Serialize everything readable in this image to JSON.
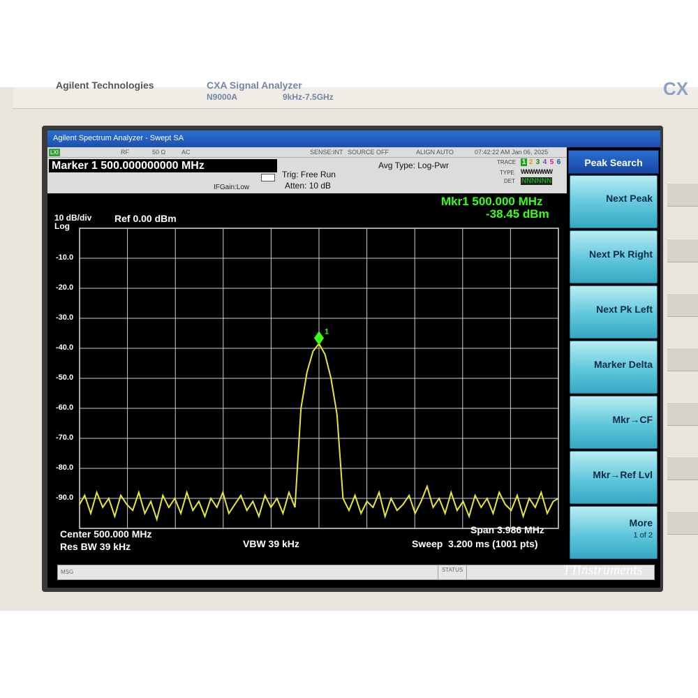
{
  "bezel": {
    "brand": "Agilent Technologies",
    "product": "CXA Signal Analyzer",
    "model": "N9000A",
    "range": "9kHz-7.5GHz",
    "series_mark": "CX"
  },
  "window": {
    "title": "Agilent Spectrum Analyzer - Swept SA"
  },
  "header": {
    "mode_badge": "LXI",
    "rf": "RF",
    "impedance": "50 Ω",
    "coupling": "AC",
    "sense": "SENSE:INT",
    "source": "SOURCE OFF",
    "align": "ALIGN AUTO",
    "timestamp": "07:42:22 AM Jan 06, 2025",
    "marker_readout": "Marker 1 500.000000000 MHz",
    "trigger": "Trig: Free Run",
    "atten": "Atten: 10 dB",
    "ifgain": "IFGain:Low",
    "avg_type": "Avg Type: Log-Pwr",
    "trace_label": "TRACE",
    "type_label": "TYPE",
    "det_label": "DET",
    "trace_digits": [
      "1",
      "2",
      "3",
      "4",
      "5",
      "6"
    ],
    "type_value": "WWWWWW",
    "det_value": "NNNNNN"
  },
  "plot": {
    "scale": "10 dB/div",
    "scale_type": "Log",
    "ref_level": "Ref 0.00 dBm",
    "marker_freq": "Mkr1 500.000 MHz",
    "marker_amp": "-38.45 dBm",
    "marker_label": "1",
    "y_ticks": [
      "-10.0",
      "-20.0",
      "-30.0",
      "-40.0",
      "-50.0",
      "-60.0",
      "-70.0",
      "-80.0",
      "-90.0"
    ],
    "center": "Center 500.000 MHz",
    "res_bw": "Res BW 39 kHz",
    "vbw": "VBW 39 kHz",
    "span": "Span 3.986 MHz",
    "sweep": "Sweep  3.200 ms (1001 pts)"
  },
  "softkeys": {
    "menu_title": "Peak Search",
    "items": [
      "Next Peak",
      "Next Pk Right",
      "Next Pk Left",
      "Marker Delta",
      "Mkr→CF",
      "Mkr→Ref Lvl",
      "More"
    ],
    "more_sub": "1 of 2"
  },
  "status": {
    "msg": "MSG",
    "status": "STATUS"
  },
  "watermark": "TTinstruments",
  "colors": {
    "trace": "#e8e83a",
    "marker": "#39ff14",
    "softkey": "#5fc7da",
    "titlebar": "#1b4fae"
  },
  "chart_data": {
    "type": "line",
    "x_unit": "MHz",
    "y_unit": "dBm",
    "xlim": [
      498.007,
      501.993
    ],
    "ylim": [
      -100,
      0
    ],
    "grid": true,
    "series": [
      {
        "x": [
          498.007,
          498.05,
          498.1,
          498.15,
          498.2,
          498.25,
          498.3,
          498.35,
          498.4,
          498.45,
          498.5,
          498.55,
          498.6,
          498.65,
          498.7,
          498.75,
          498.8,
          498.85,
          498.9,
          498.95,
          499.0,
          499.05,
          499.1,
          499.15,
          499.2,
          499.25,
          499.3,
          499.35,
          499.4,
          499.45,
          499.5,
          499.55,
          499.6,
          499.65,
          499.7,
          499.75,
          499.8,
          499.85,
          499.9,
          499.95,
          500.0,
          500.05,
          500.1,
          500.15,
          500.2,
          500.25,
          500.3,
          500.35,
          500.4,
          500.45,
          500.5,
          500.55,
          500.6,
          500.65,
          500.7,
          500.75,
          500.8,
          500.85,
          500.9,
          500.95,
          501.0,
          501.05,
          501.1,
          501.15,
          501.2,
          501.25,
          501.3,
          501.35,
          501.4,
          501.45,
          501.5,
          501.55,
          501.6,
          501.65,
          501.7,
          501.75,
          501.8,
          501.85,
          501.9,
          501.95,
          501.993
        ],
        "y": [
          -92,
          -89,
          -95,
          -88,
          -93,
          -90,
          -96,
          -89,
          -92,
          -94,
          -88,
          -95,
          -91,
          -97,
          -89,
          -93,
          -90,
          -95,
          -88,
          -94,
          -91,
          -96,
          -90,
          -93,
          -88,
          -95,
          -92,
          -89,
          -94,
          -91,
          -96,
          -89,
          -93,
          -90,
          -95,
          -88,
          -93,
          -60,
          -48,
          -41,
          -38.45,
          -42,
          -50,
          -62,
          -90,
          -94,
          -89,
          -95,
          -91,
          -93,
          -88,
          -96,
          -90,
          -94,
          -92,
          -89,
          -95,
          -91,
          -86,
          -93,
          -90,
          -95,
          -88,
          -94,
          -91,
          -96,
          -89,
          -93,
          -90,
          -95,
          -88,
          -92,
          -94,
          -89,
          -96,
          -90,
          -93,
          -88,
          -95,
          -91,
          -90
        ]
      }
    ]
  }
}
